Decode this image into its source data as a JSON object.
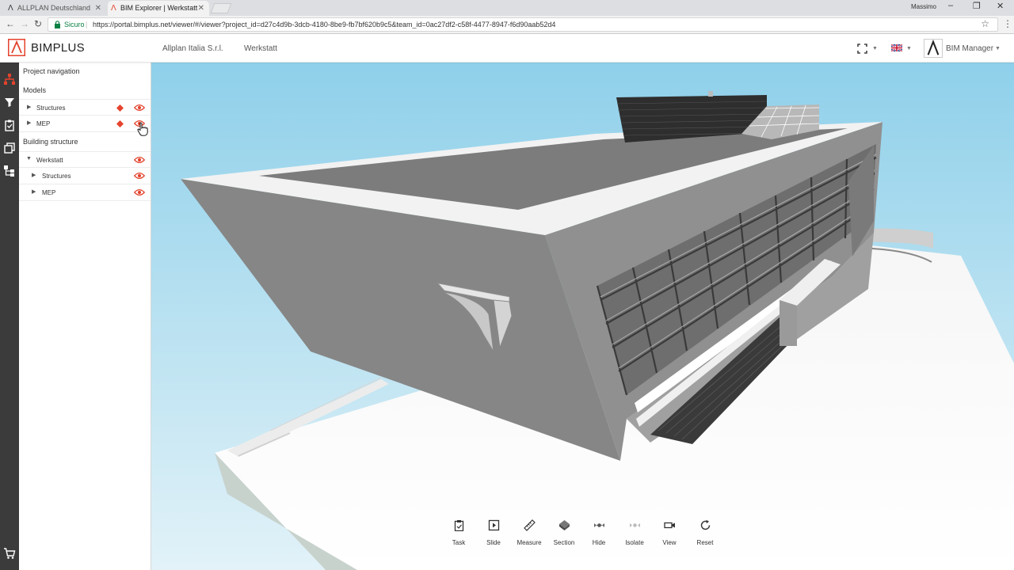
{
  "browser": {
    "tabs": [
      {
        "title": "ALLPLAN Deutschland",
        "favicon": "allplan-icon",
        "active": false
      },
      {
        "title": "BIM Explorer | Werkstatt",
        "favicon": "bimplus-icon",
        "active": true
      }
    ],
    "window_user": "Massimo",
    "secure_label": "Sicuro",
    "url": "https://portal.bimplus.net/viewer/#/viewer?project_id=d27c4d9b-3dcb-4180-8be9-fb7bf620b9c5&team_id=0ac27df2-c58f-4477-8947-f6d90aab52d4"
  },
  "header": {
    "logo_text": "BIMPLUS",
    "breadcrumbs": [
      "Allplan Italia S.r.l.",
      "Werkstatt"
    ],
    "user_label": "BIM Manager",
    "language": "en-gb-flag-icon"
  },
  "left_toolbar": {
    "tools": [
      "hierarchy-icon",
      "filter-icon",
      "clipboard-icon",
      "layers-icon",
      "structure-tree-icon"
    ],
    "bottom_tool": "cart-icon"
  },
  "navigation": {
    "title": "Project navigation",
    "models_title": "Models",
    "models": [
      {
        "label": "Structures",
        "visible": true
      },
      {
        "label": "MEP",
        "visible": true
      }
    ],
    "building_title": "Building structure",
    "building": [
      {
        "label": "Werkstatt",
        "expanded": true,
        "level": 0
      },
      {
        "label": "Structures",
        "expanded": false,
        "level": 1
      },
      {
        "label": "MEP",
        "expanded": false,
        "level": 1
      }
    ]
  },
  "viewer_tools": [
    {
      "label": "Task",
      "icon": "task-icon"
    },
    {
      "label": "Slide",
      "icon": "slide-icon"
    },
    {
      "label": "Measure",
      "icon": "ruler-icon"
    },
    {
      "label": "Section",
      "icon": "section-icon"
    },
    {
      "label": "Hide",
      "icon": "hide-icon"
    },
    {
      "label": "Isolate",
      "icon": "isolate-icon"
    },
    {
      "label": "View",
      "icon": "camera-icon"
    },
    {
      "label": "Reset",
      "icon": "reset-icon"
    }
  ],
  "colors": {
    "accent": "#e4432d",
    "sky_top": "#8fd0ea",
    "sky_bottom": "#dff1f8",
    "toolbar": "#3b3b3b"
  }
}
